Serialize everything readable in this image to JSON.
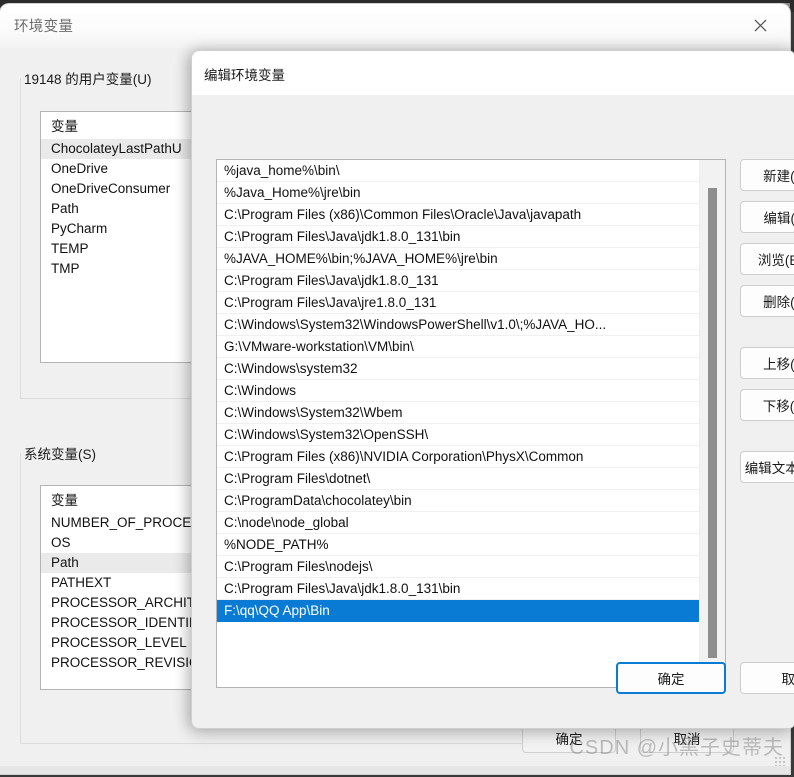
{
  "window": {
    "title": "环境变量",
    "close_icon": "close-icon"
  },
  "user_vars": {
    "label": "19148 的用户变量(U)",
    "column_header": "变量",
    "items": [
      "ChocolateyLastPathU",
      "OneDrive",
      "OneDriveConsumer",
      "Path",
      "PyCharm",
      "TEMP",
      "TMP"
    ],
    "selected": "ChocolateyLastPathU"
  },
  "system_vars": {
    "label": "系统变量(S)",
    "column_header": "变量",
    "items": [
      "NUMBER_OF_PROCES",
      "OS",
      "Path",
      "PATHEXT",
      "PROCESSOR_ARCHIT",
      "PROCESSOR_IDENTIF",
      "PROCESSOR_LEVEL",
      "PROCESSOR_REVISIO"
    ],
    "selected": "Path"
  },
  "edit_dialog": {
    "title": "编辑环境变量",
    "paths": [
      "%java_home%\\bin\\",
      "%Java_Home%\\jre\\bin",
      "C:\\Program Files (x86)\\Common Files\\Oracle\\Java\\javapath",
      "C:\\Program Files\\Java\\jdk1.8.0_131\\bin",
      "%JAVA_HOME%\\bin;%JAVA_HOME%\\jre\\bin",
      "C:\\Program Files\\Java\\jdk1.8.0_131",
      "C:\\Program Files\\Java\\jre1.8.0_131",
      "C:\\Windows\\System32\\WindowsPowerShell\\v1.0\\;%JAVA_HO...",
      "G:\\VMware-workstation\\VM\\bin\\",
      "C:\\Windows\\system32",
      "C:\\Windows",
      "C:\\Windows\\System32\\Wbem",
      "C:\\Windows\\System32\\OpenSSH\\",
      "C:\\Program Files (x86)\\NVIDIA Corporation\\PhysX\\Common",
      "C:\\Program Files\\dotnet\\",
      "C:\\ProgramData\\chocolatey\\bin",
      "C:\\node\\node_global",
      "%NODE_PATH%",
      "C:\\Program Files\\nodejs\\",
      "C:\\Program Files\\Java\\jdk1.8.0_131\\bin",
      "F:\\qq\\QQ App\\Bin"
    ],
    "selected_index": 20,
    "side_buttons": [
      "新建(N)",
      "编辑(E)",
      "浏览(B)...",
      "删除(D)",
      "上移(U)",
      "下移(O)",
      "编辑文本(T)..."
    ],
    "ok_label": "确定",
    "cancel_label": "取消"
  },
  "outer_buttons": {
    "ok_label": "确定",
    "cancel_label": "取消"
  },
  "watermark": {
    "text": "CSDN @小黑子史蒂夫"
  },
  "colors": {
    "selection_blue": "#0a7bd4",
    "dialog_bg": "#f0f0f0",
    "list_bg": "#ffffff"
  }
}
